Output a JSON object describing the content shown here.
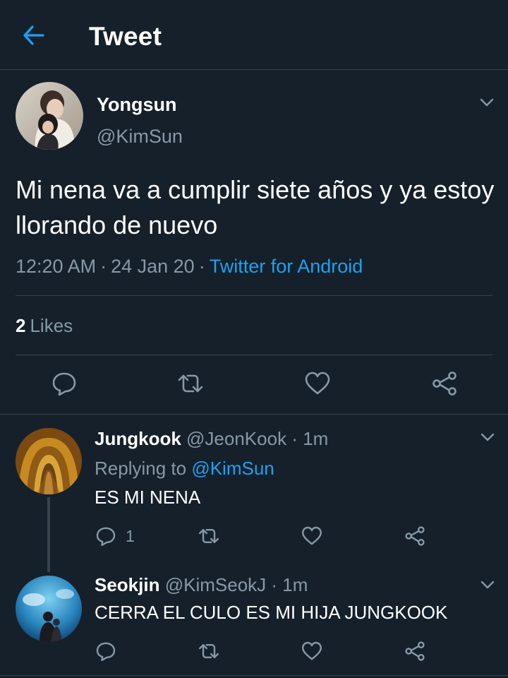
{
  "header": {
    "title": "Tweet"
  },
  "tweet": {
    "author_name": "Yongsun",
    "author_handle": "@KimSun",
    "text": "Mi nena va a cumplir siete años y ya estoy llorando de nuevo",
    "time": "12:20 AM",
    "date": "24 Jan 20",
    "separator": "·",
    "source": "Twitter for Android",
    "likes_count": "2",
    "likes_label": "Likes"
  },
  "replies": [
    {
      "name": "Jungkook",
      "handle": "@JeonKook",
      "separator": "·",
      "time": "1m",
      "replying_label": "Replying to",
      "replying_to": "@KimSun",
      "text": "ES MI NENA",
      "reply_count": "1"
    },
    {
      "name": "Seokjin",
      "handle": "@KimSeokJ",
      "separator": "·",
      "time": "1m",
      "text": "CERRA EL CULO ES MI HIJA JUNGKOOK"
    }
  ],
  "icons": {
    "back": "arrow-left-icon",
    "more": "chevron-down-icon",
    "reply": "comment-icon",
    "retweet": "retweet-icon",
    "like": "heart-icon",
    "share": "share-icon"
  },
  "colors": {
    "background": "#15202b",
    "divider": "#38444d",
    "secondary_text": "#8899a6",
    "accent": "#1da1f2"
  }
}
